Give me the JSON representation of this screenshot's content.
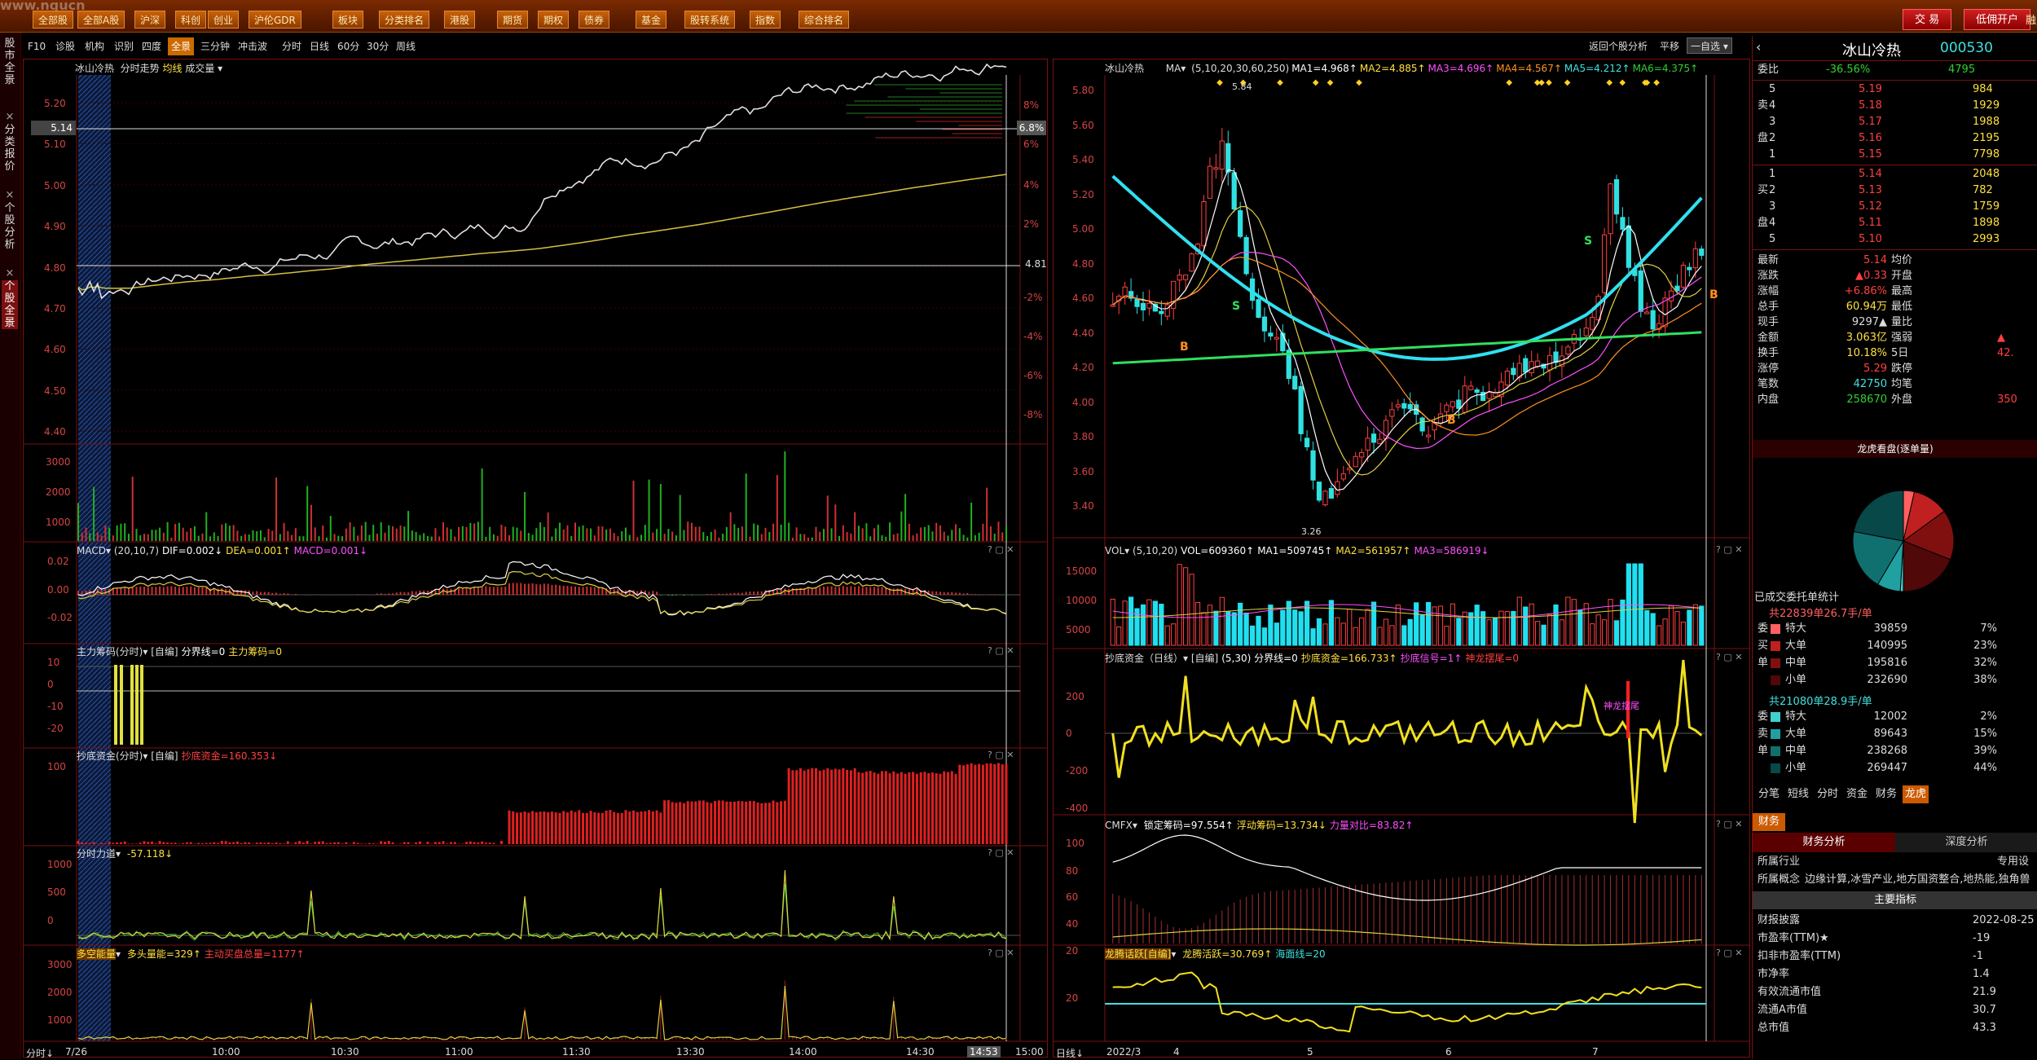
{
  "app": {
    "watermark": "www.ngucn"
  },
  "topnav": [
    {
      "label": "全部股"
    },
    {
      "label": "全部A股"
    },
    {
      "label": "沪深"
    },
    {
      "label": "科创"
    },
    {
      "label": "创业"
    },
    {
      "label": "沪伦GDR"
    },
    {
      "label": "板块"
    },
    {
      "label": "分类排名"
    },
    {
      "label": "港股"
    },
    {
      "label": "期货"
    },
    {
      "label": "期权"
    },
    {
      "label": "债券"
    },
    {
      "label": "基金"
    },
    {
      "label": "股转系统"
    },
    {
      "label": "指数"
    },
    {
      "label": "综合排名"
    }
  ],
  "topright": {
    "trade": "交 易",
    "open_account": "低佣开户",
    "more": "融"
  },
  "toolbar_left": [
    "F10",
    "诊股",
    "机构",
    "识别",
    "四度",
    "全景",
    "三分钟",
    "冲击波"
  ],
  "toolbar_period": [
    "分时",
    "日线",
    "60分",
    "30分",
    "周线"
  ],
  "toolbar_right": {
    "back": "返回个股分析",
    "pan": "平移",
    "select": "一自选"
  },
  "leftstrip": [
    "股市全景",
    "分类报价",
    "个股分析",
    "个股全景"
  ],
  "intraday": {
    "title": "冰山冷热",
    "subtitle": "分时走势",
    "avg_label": "均线",
    "vol_label": "成交量",
    "price_ticks": [
      "5.20",
      "5.10",
      "5.00",
      "4.90",
      "4.80",
      "4.70",
      "4.60",
      "4.50",
      "4.40"
    ],
    "pct_ticks": [
      "8%",
      "6%",
      "4%",
      "2%",
      "-2%",
      "-4%",
      "-6%",
      "-8%"
    ],
    "cur_price": "5.14",
    "cur_pct": "6.8%",
    "prev_close": "4.81",
    "vol_ticks": [
      "3000",
      "2000",
      "1000"
    ],
    "time_ticks": [
      "7/26",
      "10:00",
      "10:30",
      "11:00",
      "11:30",
      "13:30",
      "14:00",
      "14:30",
      "14:53",
      "15:00"
    ],
    "footer_label": "分时"
  },
  "sub_left": [
    {
      "title": "MACD",
      "params": "(20,10,7)",
      "items": [
        {
          "t": "DIF=0.002↓",
          "c": "#fff"
        },
        {
          "t": "DEA=0.001↑",
          "c": "#ffe040"
        },
        {
          "t": "MACD=0.001↓",
          "c": "#ff50ff"
        }
      ],
      "ticks": [
        "0.02",
        "0.00",
        "-0.02"
      ]
    },
    {
      "title": "主力筹码(分时)",
      "params": "[自编]",
      "items": [
        {
          "t": "分界线=0",
          "c": "#fff"
        },
        {
          "t": "主力筹码=0",
          "c": "#ffe040"
        }
      ],
      "ticks": [
        "10",
        "0",
        "-10",
        "-20"
      ]
    },
    {
      "title": "抄底资金(分时)",
      "params": "[自编]",
      "items": [
        {
          "t": "抄底资金=160.353↓",
          "c": "#ff4040"
        }
      ],
      "ticks": [
        "100"
      ]
    },
    {
      "title": "分时力道",
      "params": "",
      "items": [
        {
          "t": "-57.118↓",
          "c": "#ffe040"
        }
      ],
      "ticks": [
        "1000",
        "500",
        "0"
      ]
    },
    {
      "title": "多空能量",
      "params": "",
      "items": [
        {
          "t": "多头量能=329↑",
          "c": "#ffe040"
        },
        {
          "t": "主动买盘总量=1177↑",
          "c": "#ff4040"
        }
      ],
      "ticks": [
        "3000",
        "2000",
        "1000"
      ]
    }
  ],
  "daily": {
    "title": "冰山冷热",
    "ma_label": "MA",
    "ma": [
      {
        "t": "(5,10,20,30,60,250)",
        "c": "#ddd"
      },
      {
        "t": "MA1=4.968↑",
        "c": "#fff"
      },
      {
        "t": "MA2=4.885↑",
        "c": "#ffe040"
      },
      {
        "t": "MA3=4.696↑",
        "c": "#ff50ff"
      },
      {
        "t": "MA4=4.567↑",
        "c": "#ff9020"
      },
      {
        "t": "MA5=4.212↑",
        "c": "#40e0e0"
      },
      {
        "t": "MA6=4.375↑",
        "c": "#30d030"
      }
    ],
    "price_ticks": [
      "5.80",
      "5.60",
      "5.40",
      "5.20",
      "5.00",
      "4.80",
      "4.60",
      "4.40",
      "4.20",
      "4.00",
      "3.80",
      "3.60",
      "3.40"
    ],
    "high_label": "5.84",
    "low_label": "3.26",
    "time_ticks": [
      "2022/3",
      "4",
      "5",
      "6",
      "7"
    ],
    "footer_label": "日线"
  },
  "sub_right": [
    {
      "title": "VOL",
      "params": "(5,10,20)",
      "items": [
        {
          "t": "VOL=609360↑",
          "c": "#fff"
        },
        {
          "t": "MA1=509745↑",
          "c": "#fff"
        },
        {
          "t": "MA2=561957↑",
          "c": "#ffe040"
        },
        {
          "t": "MA3=586919↓",
          "c": "#ff50ff"
        }
      ],
      "ticks": [
        "15000",
        "10000",
        "5000"
      ]
    },
    {
      "title": "抄底资金（日线）",
      "params": "[自编]",
      "items": [
        {
          "t": "(5,30) 分界线=0",
          "c": "#fff"
        },
        {
          "t": "抄底资金=166.733↑",
          "c": "#ffe040"
        },
        {
          "t": "抄底信号=1↑",
          "c": "#ff50ff"
        },
        {
          "t": "神龙摆尾=0",
          "c": "#ff4040"
        }
      ],
      "ticks": [
        "200",
        "0",
        "-200",
        "-400"
      ],
      "annotation": "神龙摆尾"
    },
    {
      "title": "CMFX",
      "params": "",
      "items": [
        {
          "t": "锁定筹码=97.554↑",
          "c": "#fff"
        },
        {
          "t": "浮动筹码=13.734↓",
          "c": "#ffe040"
        },
        {
          "t": "力量对比=83.82↑",
          "c": "#ff50ff"
        }
      ],
      "ticks": [
        "100",
        "80",
        "60",
        "40",
        "20"
      ]
    },
    {
      "title": "龙腾话跃[自编]",
      "params": "",
      "items": [
        {
          "t": "龙腾活跃=30.769↑",
          "c": "#ffe040"
        },
        {
          "t": "海面线=20",
          "c": "#40e0e0"
        }
      ],
      "ticks": [
        "20"
      ]
    }
  ],
  "quote": {
    "name": "冰山冷热",
    "code": "000530",
    "weibi_label": "委比",
    "weibi": "-36.56%",
    "weibi_vol": "4795",
    "asks": [
      {
        "lvl": "5",
        "p": "5.19",
        "v": "984"
      },
      {
        "lvl": "4",
        "p": "5.18",
        "v": "1929"
      },
      {
        "lvl": "3",
        "p": "5.17",
        "v": "1988"
      },
      {
        "lvl": "2",
        "p": "5.16",
        "v": "2195"
      },
      {
        "lvl": "1",
        "p": "5.15",
        "v": "7798"
      }
    ],
    "bids": [
      {
        "lvl": "1",
        "p": "5.14",
        "v": "2048"
      },
      {
        "lvl": "2",
        "p": "5.13",
        "v": "782"
      },
      {
        "lvl": "3",
        "p": "5.12",
        "v": "1759"
      },
      {
        "lvl": "4",
        "p": "5.11",
        "v": "1898"
      },
      {
        "lvl": "5",
        "p": "5.10",
        "v": "2993"
      }
    ],
    "ask_label": "卖",
    "bid_label": "买",
    "pan_label": "盘",
    "stats": [
      {
        "k": "最新",
        "v": "5.14",
        "c": "#ff4040",
        "k2": "均价",
        "v2": ""
      },
      {
        "k": "涨跌",
        "v": "▲0.33",
        "c": "#ff4040",
        "k2": "开盘",
        "v2": ""
      },
      {
        "k": "涨幅",
        "v": "+6.86%",
        "c": "#ff4040",
        "k2": "最高",
        "v2": ""
      },
      {
        "k": "总手",
        "v": "60.94万",
        "c": "#ffe040",
        "k2": "最低",
        "v2": ""
      },
      {
        "k": "现手",
        "v": "9297▲",
        "c": "#ddd",
        "k2": "量比",
        "v2": ""
      },
      {
        "k": "金额",
        "v": "3.063亿",
        "c": "#ffe040",
        "k2": "强弱",
        "v2": "▲"
      },
      {
        "k": "换手",
        "v": "10.18%",
        "c": "#ffe040",
        "k2": "5日",
        "v2": "42."
      },
      {
        "k": "涨停",
        "v": "5.29",
        "c": "#ff4040",
        "k2": "跌停",
        "v2": ""
      },
      {
        "k": "笔数",
        "v": "42750",
        "c": "#40e0e0",
        "k2": "均笔",
        "v2": ""
      },
      {
        "k": "内盘",
        "v": "258670",
        "c": "#30d030",
        "k2": "外盘",
        "v2": "350"
      }
    ],
    "pie_title": "龙虎看盘(逐单量)",
    "pie": [
      {
        "v": 7,
        "c": "#ff6060"
      },
      {
        "v": 23,
        "c": "#c02020"
      },
      {
        "v": 32,
        "c": "#801010"
      },
      {
        "v": 38,
        "c": "#500808"
      },
      {
        "v": 2,
        "c": "#40d0d0"
      },
      {
        "v": 15,
        "c": "#20a0a0"
      },
      {
        "v": 39,
        "c": "#107070"
      },
      {
        "v": 44,
        "c": "#084848"
      }
    ],
    "orders_title": "已成交委托单统计",
    "buy_total": "共22839单26.7手/单",
    "buy": [
      {
        "k": "特大",
        "v": "39859",
        "p": "7%",
        "c": "#ff6060"
      },
      {
        "k": "大单",
        "v": "140995",
        "p": "23%",
        "c": "#c02020"
      },
      {
        "k": "中单",
        "v": "195816",
        "p": "32%",
        "c": "#801010"
      },
      {
        "k": "小单",
        "v": "232690",
        "p": "38%",
        "c": "#500808"
      }
    ],
    "buy_side": [
      "委",
      "买",
      "单"
    ],
    "sell_total": "共21080单28.9手/单",
    "sell": [
      {
        "k": "特大",
        "v": "12002",
        "p": "2%",
        "c": "#40d0d0"
      },
      {
        "k": "大单",
        "v": "89643",
        "p": "15%",
        "c": "#20a0a0"
      },
      {
        "k": "中单",
        "v": "238268",
        "p": "39%",
        "c": "#107070"
      },
      {
        "k": "小单",
        "v": "269447",
        "p": "44%",
        "c": "#084848"
      }
    ],
    "sell_side": [
      "委",
      "卖",
      "单"
    ],
    "tabs": [
      "分笔",
      "短线",
      "分时",
      "资金",
      "财务",
      "龙虎"
    ],
    "fin_tab": "财务",
    "fin_sub": [
      "财务分析",
      "深度分析"
    ],
    "industry_k": "所属行业",
    "industry_v": "专用设",
    "concept_k": "所属概念",
    "concept_v": "边缘计算,冰雪产业,地方国资整合,地热能,独角兽",
    "main_idx": "主要指标",
    "fin": [
      {
        "k": "财报披露",
        "v": "2022-08-25"
      },
      {
        "k": "市盈率(TTM)★",
        "v": "-19"
      },
      {
        "k": "扣非市盈率(TTM)",
        "v": "-1"
      },
      {
        "k": "市净率",
        "v": "1.4"
      },
      {
        "k": "有效流通市值",
        "v": "21.9"
      },
      {
        "k": "流通A市值",
        "v": "30.7"
      },
      {
        "k": "总市值",
        "v": "43.3"
      }
    ]
  }
}
